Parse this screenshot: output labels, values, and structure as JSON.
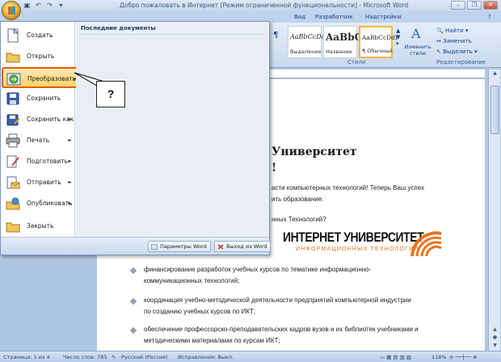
{
  "window": {
    "title": "Добро пожаловать в Интернет [Режим ограниченной функциональности] - Microsoft Word"
  },
  "ribbon": {
    "tabs": [
      "Вид",
      "Разработчик",
      "Надстройки"
    ],
    "styles": [
      {
        "sample": "AaBbCcDc",
        "name": "Выделение"
      },
      {
        "sample": "AaBbC",
        "name": "Название"
      },
      {
        "sample": "AaBbCcDdI",
        "name": "¶ Обычный"
      }
    ],
    "change_styles": "Изменить стили",
    "groups": {
      "styles": "Стили",
      "editing": "Редактирование"
    },
    "editing": {
      "find": "Найти",
      "replace": "Заменить",
      "select": "Выделить"
    }
  },
  "menu": {
    "items": [
      {
        "label": "Создать",
        "icon": "new-document-icon"
      },
      {
        "label": "Открыть",
        "icon": "open-folder-icon"
      },
      {
        "label": "Преобразовать",
        "icon": "convert-icon"
      },
      {
        "label": "Сохранить",
        "icon": "save-icon"
      },
      {
        "label": "Сохранить как",
        "icon": "save-as-icon"
      },
      {
        "label": "Печать",
        "icon": "print-icon"
      },
      {
        "label": "Подготовить",
        "icon": "prepare-icon"
      },
      {
        "label": "Отправить",
        "icon": "send-icon"
      },
      {
        "label": "Опубликовать",
        "icon": "publish-icon"
      },
      {
        "label": "Закрыть",
        "icon": "close-folder-icon"
      }
    ],
    "recent_header": "Последние документы",
    "options_button": "Параметры Word",
    "exit_button": "Выход из Word"
  },
  "callout": {
    "text": "?"
  },
  "document": {
    "heading1": "Университет",
    "heading2": "!",
    "para1a": "асти компьютерных технологий! Теперь Ваш успех",
    "para1b": "ить образование.",
    "para2": "нных Технологий?",
    "logo_main": "ИНТЕРНЕТ УНИВЕРСИТЕТ",
    "logo_sub": "ИНФОРМАЦИОННЫХ ТЕХНОЛОГИЙ",
    "bullets": [
      [
        "финансирование разработок учебных курсов по тематике информационно-",
        "коммуникационных технологий;"
      ],
      [
        "координация учебно-методической деятельности предприятий компьютерной индустрии",
        "по созданию учебных курсов по ИКТ;"
      ],
      [
        "обеспечение профессорско-преподавательских кадров вузов и их библиотек учебниками и",
        "методическими материалами по курсам ИКТ;"
      ]
    ]
  },
  "statusbar": {
    "page": "Страница: 1 из 4",
    "words": "Число слов: 785",
    "language": "Русский (Россия)",
    "track": "Исправления: Выкл.",
    "zoom": "118%"
  },
  "colors": {
    "accent_highlight": "#e15d0c",
    "logo_orange": "#e8741c"
  }
}
